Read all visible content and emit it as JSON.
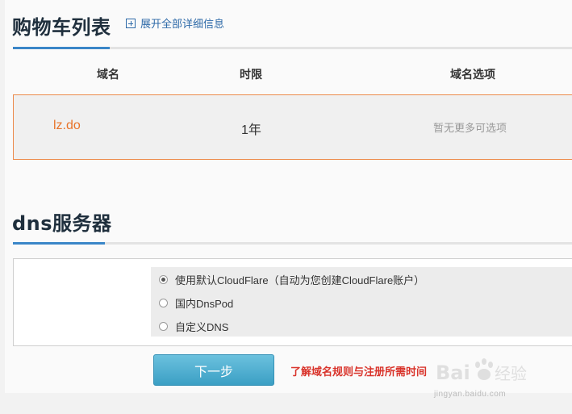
{
  "cart": {
    "title": "购物车列表",
    "expand_label": "展开全部详细信息",
    "columns": [
      "域名",
      "时限",
      "域名选项"
    ],
    "rows": [
      {
        "domain": "lz.do",
        "term": "1年",
        "options": "暂无更多可选项"
      }
    ]
  },
  "dns": {
    "title": "dns服务器",
    "options": [
      {
        "label": "使用默认CloudFlare（自动为您创建CloudFlare账户）",
        "selected": true
      },
      {
        "label": "国内DnsPod",
        "selected": false
      },
      {
        "label": "自定义DNS",
        "selected": false
      }
    ]
  },
  "actions": {
    "next_label": "下一步",
    "rules_link": "了解域名规则与注册所需时间"
  },
  "watermark": {
    "brand": "Baidu经验",
    "url": "jingyan.baidu.com"
  },
  "colors": {
    "accent_blue": "#3a86c8",
    "domain_orange": "#e8742a",
    "row_border": "#ec8a4a",
    "link_red": "#d9342b",
    "button_blue": "#4aa9cc"
  }
}
